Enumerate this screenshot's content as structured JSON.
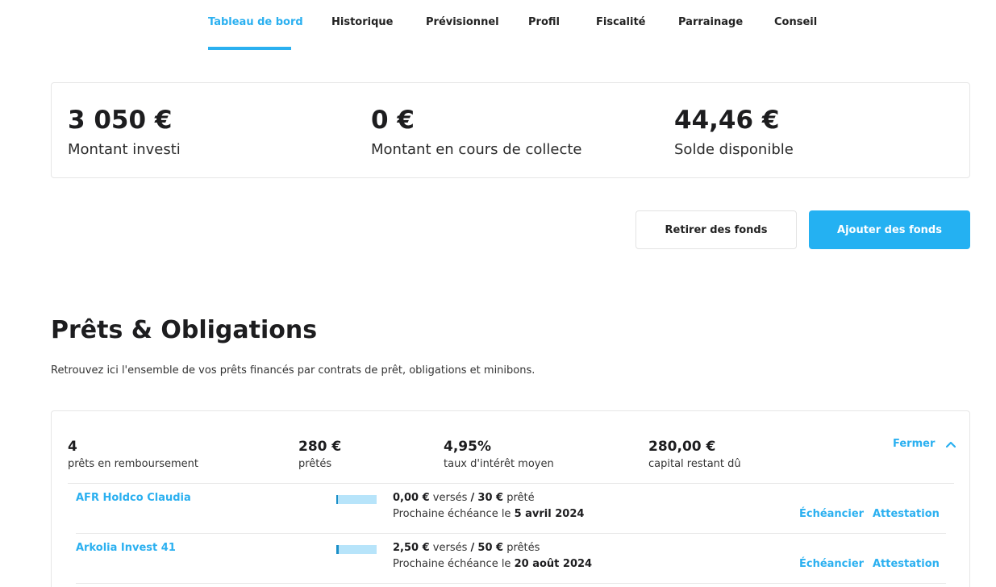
{
  "nav": {
    "tabs": [
      {
        "label": "Tableau de bord",
        "active": true
      },
      {
        "label": "Historique"
      },
      {
        "label": "Prévisionnel"
      },
      {
        "label": "Profil"
      },
      {
        "label": "Fiscalité"
      },
      {
        "label": "Parrainage"
      },
      {
        "label": "Conseil"
      }
    ]
  },
  "summary": {
    "invested": {
      "value": "3 050 €",
      "label": "Montant investi"
    },
    "collecting": {
      "value": "0 €",
      "label": "Montant en cours de collecte"
    },
    "balance": {
      "value": "44,46 €",
      "label": "Solde disponible"
    }
  },
  "actions": {
    "withdraw_label": "Retirer des fonds",
    "add_label": "Ajouter des fonds"
  },
  "loans_section": {
    "title": "Prêts & Obligations",
    "description": "Retrouvez ici l'ensemble de vos prêts financés par contrats de prêt, obligations et minibons.",
    "stats": {
      "count": {
        "value": "4",
        "label": "prêts en remboursement"
      },
      "lent": {
        "value": "280 €",
        "label": "prêtés"
      },
      "rate": {
        "value": "4,95%",
        "label": "taux d'intérêt moyen"
      },
      "remaining": {
        "value": "280,00 €",
        "label": "capital restant dû"
      }
    },
    "toggle_label": "Fermer",
    "rows": [
      {
        "name": "AFR Holdco Claudia",
        "repaid_fraction": 0.0,
        "paid": "0,00 €",
        "paid_suffix": "versés",
        "sep": "/",
        "lent": "30 €",
        "lent_suffix": "prêté",
        "next_label": "Prochaine échéance le",
        "next_date": "5 avril 2024",
        "schedule_label": "Échéancier",
        "certificate_label": "Attestation"
      },
      {
        "name": "Arkolia Invest 41",
        "repaid_fraction": 0.05,
        "paid": "2,50 €",
        "paid_suffix": "versés",
        "sep": "/",
        "lent": "50 €",
        "lent_suffix": "prêtés",
        "next_label": "Prochaine échéance le",
        "next_date": "20 août 2024",
        "schedule_label": "Échéancier",
        "certificate_label": "Attestation"
      }
    ]
  },
  "colors": {
    "accent": "#2bb0f0",
    "primary_button": "#24b1f2",
    "bar_track": "#b7e4fa",
    "bar_fill": "#1a8fc8"
  }
}
